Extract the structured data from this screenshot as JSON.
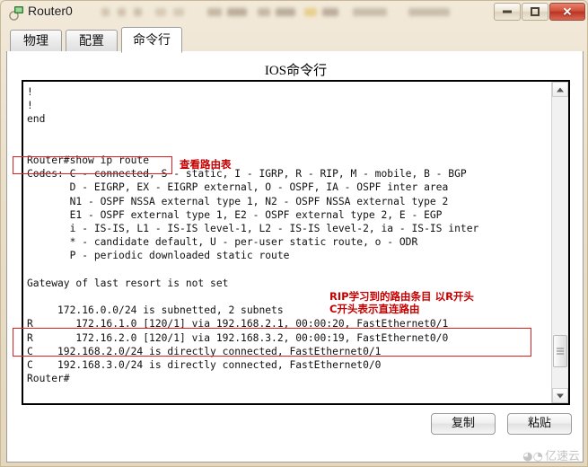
{
  "window": {
    "title": "Router0",
    "icon": "router-icon",
    "controls": {
      "minimize": "–",
      "maximize": "□",
      "close": "✕"
    }
  },
  "tabs": [
    {
      "label": "物理",
      "active": false
    },
    {
      "label": "配置",
      "active": false
    },
    {
      "label": "命令行",
      "active": true
    }
  ],
  "panel": {
    "title": "IOS命令行"
  },
  "console": {
    "text": "!\n!\nend\n\n\nRouter#show ip route\nCodes: C - connected, S - static, I - IGRP, R - RIP, M - mobile, B - BGP\n       D - EIGRP, EX - EIGRP external, O - OSPF, IA - OSPF inter area\n       N1 - OSPF NSSA external type 1, N2 - OSPF NSSA external type 2\n       E1 - OSPF external type 1, E2 - OSPF external type 2, E - EGP\n       i - IS-IS, L1 - IS-IS level-1, L2 - IS-IS level-2, ia - IS-IS inter\n       * - candidate default, U - per-user static route, o - ODR\n       P - periodic downloaded static route\n\nGateway of last resort is not set\n\n     172.16.0.0/24 is subnetted, 2 subnets\nR       172.16.1.0 [120/1] via 192.168.2.1, 00:00:20, FastEthernet0/1\nR       172.16.2.0 [120/1] via 192.168.3.2, 00:00:19, FastEthernet0/0\nC    192.168.2.0/24 is directly connected, FastEthernet0/1\nC    192.168.3.0/24 is directly connected, FastEthernet0/0\nRouter#"
  },
  "routing_table": {
    "command": "Router#show ip route",
    "gateway_of_last_resort": "not set",
    "subnet_note": "172.16.0.0/24 is subnetted, 2 subnets",
    "prompt": "Router#",
    "entries": [
      {
        "code": "R",
        "network": "172.16.1.0",
        "metric": "[120/1]",
        "via": "192.168.2.1",
        "age": "00:00:20",
        "interface": "FastEthernet0/1"
      },
      {
        "code": "R",
        "network": "172.16.2.0",
        "metric": "[120/1]",
        "via": "192.168.3.2",
        "age": "00:00:19",
        "interface": "FastEthernet0/0"
      },
      {
        "code": "C",
        "network": "192.168.2.0/24",
        "metric": "",
        "via": "directly connected",
        "age": "",
        "interface": "FastEthernet0/1"
      },
      {
        "code": "C",
        "network": "192.168.3.0/24",
        "metric": "",
        "via": "directly connected",
        "age": "",
        "interface": "FastEthernet0/0"
      }
    ]
  },
  "annotations": {
    "command_note": "查看路由表",
    "routes_note": "RIP学习到的路由条目 以R开头\nC开头表示直连路由"
  },
  "buttons": {
    "copy": "复制",
    "paste": "粘贴"
  },
  "watermark": {
    "icon": "cloud-logo-icon",
    "text": "亿速云"
  },
  "colors": {
    "annotation_red": "#c80000",
    "highlight_box": "#e02020",
    "close_button": "#c4412f",
    "window_chrome": "#eadfca"
  }
}
